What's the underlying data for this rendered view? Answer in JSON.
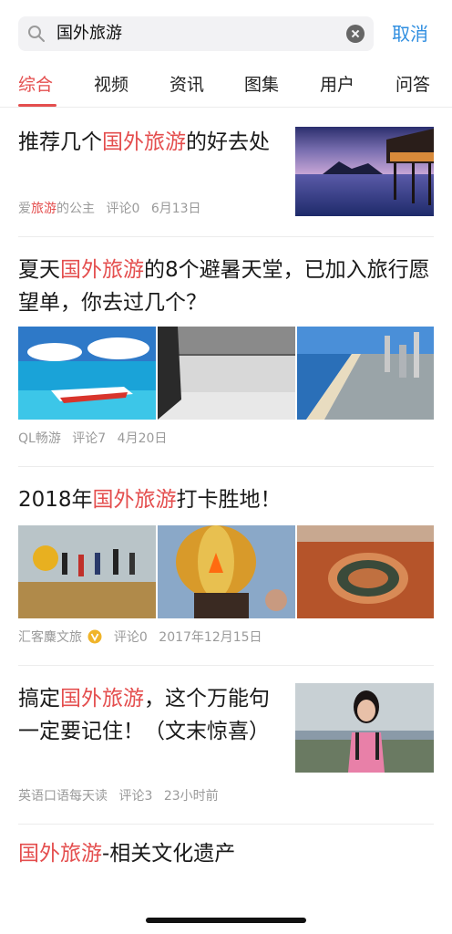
{
  "search": {
    "query": "国外旅游",
    "cancel_label": "取消"
  },
  "tabs": [
    "综合",
    "视频",
    "资讯",
    "图集",
    "用户",
    "问答"
  ],
  "articles": [
    {
      "title_pre": "推荐几个",
      "title_hl": "国外旅游",
      "title_post": "的好去处",
      "author_pre": "爱",
      "author_hl": "旅游",
      "author_post": "的公主",
      "comments": "评论0",
      "date": "6月13日"
    },
    {
      "title_pre": "夏天",
      "title_hl": "国外旅游",
      "title_post": "的8个避暑天堂，已加入旅行愿望单，你去过几个？",
      "author": "QL畅游",
      "comments": "评论7",
      "date": "4月20日"
    },
    {
      "title_pre": "2018年",
      "title_hl": "国外旅游",
      "title_post": "打卡胜地！",
      "author": "汇客麋文旅",
      "verified_icon": "verified-v-icon",
      "comments": "评论0",
      "date": "2017年12月15日"
    },
    {
      "title_pre": "搞定",
      "title_hl": "国外旅游",
      "title_post": "，这个万能句一定要记住！（文末惊喜）",
      "author": "英语口语每天读",
      "comments": "评论3",
      "date": "23小时前"
    },
    {
      "title_hl": "国外旅游",
      "title_post": "-相关文化遗产"
    }
  ],
  "colors": {
    "accent": "#e44e4e",
    "link": "#2f8ee0",
    "meta": "#9a9a9a"
  }
}
